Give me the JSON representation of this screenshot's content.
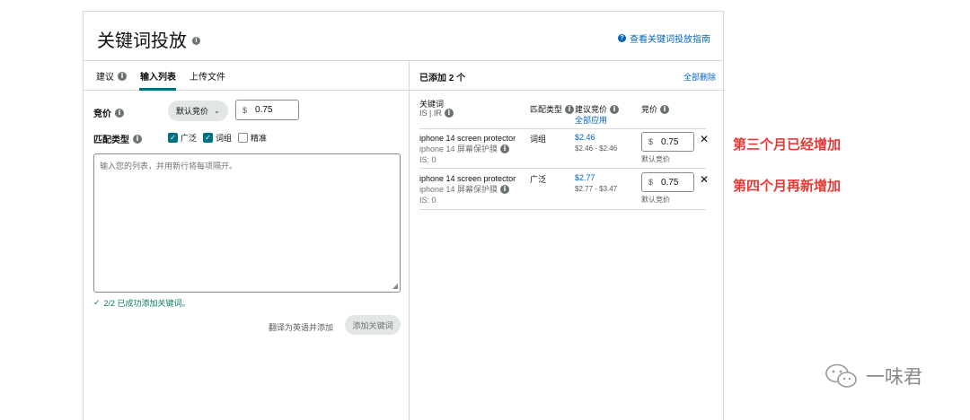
{
  "header": {
    "title": "关键词投放",
    "guide_link": "查看关键词投放指南"
  },
  "left": {
    "tabs": [
      {
        "label": "建议"
      },
      {
        "label": "输入列表"
      },
      {
        "label": "上传文件"
      }
    ],
    "bid_label": "竞价",
    "bid_dropdown": "默认竞价",
    "bid_currency": "$",
    "bid_value": "0.75",
    "match_label": "匹配类型",
    "match_options": [
      {
        "label": "广泛",
        "checked": true
      },
      {
        "label": "词组",
        "checked": true
      },
      {
        "label": "精准",
        "checked": false
      }
    ],
    "textarea_placeholder": "输入您的列表，并用新行将每项隔开。",
    "success_message": "2/2 已成功添加关键词。",
    "translate_link": "翻译为英语并添加",
    "add_button": "添加关键词"
  },
  "right": {
    "added_count": "已添加 2 个",
    "clear_all": "全部删除",
    "columns": {
      "keyword": "关键词",
      "keyword_sub": "IS | IR",
      "match_type": "匹配类型",
      "suggested_bid": "建议竞价",
      "apply_all": "全部应用",
      "bid": "竞价"
    },
    "rows": [
      {
        "keyword": "iphone 14 screen protector",
        "translation": "iphone 14 屏幕保护膜",
        "is": "IS: 0",
        "match": "词组",
        "suggested": "$2.46",
        "range": "$2.46 - $2.46",
        "currency": "$",
        "bid": "0.75",
        "bid_note": "默认竞价"
      },
      {
        "keyword": "iphone 14 screen protector",
        "translation": "iphone 14 屏幕保护膜",
        "is": "IS: 0",
        "match": "广泛",
        "suggested": "$2.77",
        "range": "$2.77 - $3.47",
        "currency": "$",
        "bid": "0.75",
        "bid_note": "默认竞价"
      }
    ]
  },
  "annotations": {
    "first": "第三个月已经增加",
    "second": "第四个月再新增加"
  },
  "watermark": "一味君",
  "colors": {
    "link": "#0066c0",
    "accent": "#007185",
    "success": "#067d62",
    "annotation": "#e53935"
  }
}
